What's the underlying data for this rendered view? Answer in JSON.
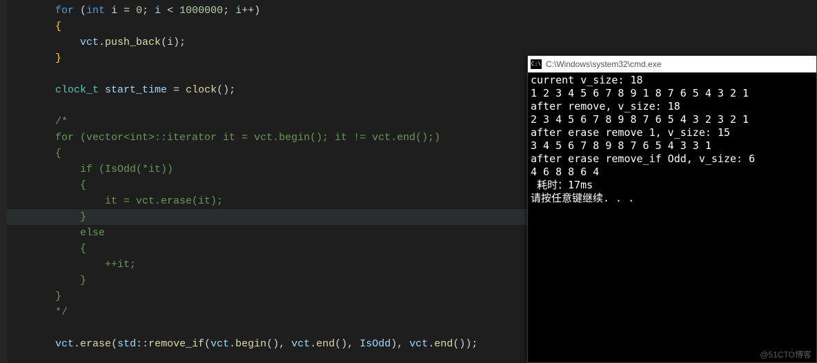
{
  "editor": {
    "lines": [
      {
        "indent": 1,
        "kind": "code",
        "tokens": [
          {
            "c": "key",
            "t": "for"
          },
          {
            "c": "punc",
            "t": " ("
          },
          {
            "c": "key",
            "t": "int"
          },
          {
            "c": "op",
            "t": " i "
          },
          {
            "c": "op",
            "t": "="
          },
          {
            "c": "op",
            "t": " "
          },
          {
            "c": "num",
            "t": "0"
          },
          {
            "c": "punc",
            "t": "; "
          },
          {
            "c": "var",
            "t": "i"
          },
          {
            "c": "op",
            "t": " < "
          },
          {
            "c": "num",
            "t": "1000000"
          },
          {
            "c": "punc",
            "t": "; "
          },
          {
            "c": "var",
            "t": "i"
          },
          {
            "c": "op",
            "t": "++"
          },
          {
            "c": "punc",
            "t": ")"
          }
        ]
      },
      {
        "indent": 1,
        "kind": "code",
        "tokens": [
          {
            "c": "brace",
            "t": "{"
          }
        ]
      },
      {
        "indent": 2,
        "kind": "code",
        "tokens": [
          {
            "c": "var",
            "t": "vct"
          },
          {
            "c": "punc",
            "t": "."
          },
          {
            "c": "fn",
            "t": "push_back"
          },
          {
            "c": "punc",
            "t": "("
          },
          {
            "c": "var",
            "t": "i"
          },
          {
            "c": "punc",
            "t": ");"
          }
        ]
      },
      {
        "indent": 1,
        "kind": "code",
        "tokens": [
          {
            "c": "brace",
            "t": "}"
          }
        ]
      },
      {
        "indent": 1,
        "kind": "blank",
        "tokens": []
      },
      {
        "indent": 1,
        "kind": "code",
        "tokens": [
          {
            "c": "type",
            "t": "clock_t"
          },
          {
            "c": "op",
            "t": " "
          },
          {
            "c": "var",
            "t": "start_time"
          },
          {
            "c": "op",
            "t": " = "
          },
          {
            "c": "fn",
            "t": "clock"
          },
          {
            "c": "punc",
            "t": "();"
          }
        ]
      },
      {
        "indent": 1,
        "kind": "blank",
        "tokens": []
      },
      {
        "indent": 1,
        "kind": "cmt",
        "tokens": [
          {
            "c": "cmt",
            "t": "/*"
          }
        ]
      },
      {
        "indent": 1,
        "kind": "cmt",
        "tokens": [
          {
            "c": "cmt",
            "t": "for (vector<int>::iterator it = vct.begin(); it != vct.end();)"
          }
        ]
      },
      {
        "indent": 1,
        "kind": "cmt",
        "tokens": [
          {
            "c": "cmt",
            "t": "{"
          }
        ]
      },
      {
        "indent": 2,
        "kind": "cmt",
        "tokens": [
          {
            "c": "cmt",
            "t": "if (IsOdd(*it))"
          }
        ]
      },
      {
        "indent": 2,
        "kind": "cmt",
        "tokens": [
          {
            "c": "cmt",
            "t": "{"
          }
        ]
      },
      {
        "indent": 3,
        "kind": "cmt",
        "tokens": [
          {
            "c": "cmt",
            "t": "it = vct.erase(it);"
          }
        ]
      },
      {
        "indent": 2,
        "kind": "cmt",
        "hl": true,
        "tokens": [
          {
            "c": "cmt",
            "t": "}"
          }
        ]
      },
      {
        "indent": 2,
        "kind": "cmt",
        "tokens": [
          {
            "c": "cmt",
            "t": "else"
          }
        ]
      },
      {
        "indent": 2,
        "kind": "cmt",
        "tokens": [
          {
            "c": "cmt",
            "t": "{"
          }
        ]
      },
      {
        "indent": 3,
        "kind": "cmt",
        "tokens": [
          {
            "c": "cmt",
            "t": "++it;"
          }
        ]
      },
      {
        "indent": 2,
        "kind": "cmt",
        "tokens": [
          {
            "c": "cmt",
            "t": "}"
          }
        ]
      },
      {
        "indent": 1,
        "kind": "cmt",
        "tokens": [
          {
            "c": "cmt",
            "t": "}"
          }
        ]
      },
      {
        "indent": 1,
        "kind": "cmt",
        "tokens": [
          {
            "c": "cmt",
            "t": "*/"
          }
        ]
      },
      {
        "indent": 1,
        "kind": "blank",
        "tokens": []
      },
      {
        "indent": 1,
        "kind": "code",
        "tokens": [
          {
            "c": "var",
            "t": "vct"
          },
          {
            "c": "punc",
            "t": "."
          },
          {
            "c": "fn",
            "t": "erase"
          },
          {
            "c": "punc",
            "t": "("
          },
          {
            "c": "var",
            "t": "std"
          },
          {
            "c": "punc",
            "t": "::"
          },
          {
            "c": "fn",
            "t": "remove_if"
          },
          {
            "c": "punc",
            "t": "("
          },
          {
            "c": "var",
            "t": "vct"
          },
          {
            "c": "punc",
            "t": "."
          },
          {
            "c": "fn",
            "t": "begin"
          },
          {
            "c": "punc",
            "t": "(), "
          },
          {
            "c": "var",
            "t": "vct"
          },
          {
            "c": "punc",
            "t": "."
          },
          {
            "c": "fn",
            "t": "end"
          },
          {
            "c": "punc",
            "t": "(), "
          },
          {
            "c": "var",
            "t": "IsOdd"
          },
          {
            "c": "punc",
            "t": "), "
          },
          {
            "c": "var",
            "t": "vct"
          },
          {
            "c": "punc",
            "t": "."
          },
          {
            "c": "fn",
            "t": "end"
          },
          {
            "c": "punc",
            "t": "());"
          }
        ]
      }
    ]
  },
  "console": {
    "icon_text": "C:\\",
    "title": "C:\\Windows\\system32\\cmd.exe",
    "lines": [
      "current v_size: 18",
      "1 2 3 4 5 6 7 8 9 1 8 7 6 5 4 3 2 1",
      "after remove, v_size: 18",
      "2 3 4 5 6 7 8 9 8 7 6 5 4 3 2 3 2 1",
      "after erase remove 1, v_size: 15",
      "3 4 5 6 7 8 9 8 7 6 5 4 3 3 1",
      "after erase remove_if Odd, v_size: 6",
      "4 6 8 8 6 4",
      " 耗时：17ms",
      "请按任意键继续. . ."
    ]
  },
  "watermark": "@51CTO博客"
}
